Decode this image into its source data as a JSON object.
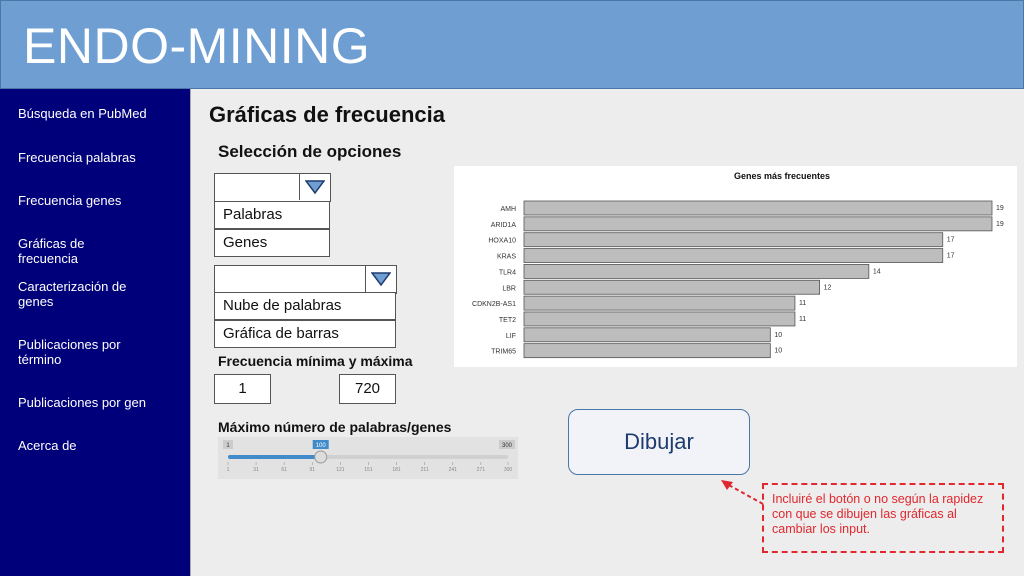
{
  "app": {
    "title": "ENDO-MINING"
  },
  "sidebar": {
    "items": [
      {
        "label": "Búsqueda en PubMed"
      },
      {
        "label": "Frecuencia palabras"
      },
      {
        "label": "Frecuencia genes"
      },
      {
        "label": "Gráficas de frecuencia"
      },
      {
        "label": "Caracterización de genes"
      },
      {
        "label": "Publicaciones por término"
      },
      {
        "label": "Publicaciones por gen"
      },
      {
        "label": "Acerca de"
      }
    ]
  },
  "main": {
    "title": "Gráficas de frecuencia",
    "section_title": "Selección de opciones",
    "dropdown1": {
      "selected": "",
      "options": [
        "Palabras",
        "Genes"
      ]
    },
    "dropdown2": {
      "selected": "",
      "options": [
        "Nube de palabras",
        "Gráfica de barras"
      ]
    },
    "freq_label": "Frecuencia mínima y máxima",
    "freq_min": "1",
    "freq_max": "720",
    "max_words_label": "Máximo número de palabras/genes",
    "slider": {
      "min": "1",
      "max": "300",
      "value": "100",
      "value_num": 100,
      "min_num": 1,
      "max_num": 300,
      "ticks": [
        "1",
        "31",
        "61",
        "91",
        "121",
        "151",
        "181",
        "211",
        "241",
        "271",
        "300"
      ]
    },
    "draw_button": "Dibujar",
    "note": "Incluiré el botón o no según la rapidez con que se dibujen las gráficas al cambiar los input."
  },
  "chart_data": {
    "type": "bar",
    "orientation": "horizontal",
    "title": "Genes más frecuentes",
    "categories": [
      "AMH",
      "ARID1A",
      "HOXA10",
      "KRAS",
      "TLR4",
      "LBR",
      "CDKN2B-AS1",
      "TET2",
      "LIF",
      "TRIM65"
    ],
    "values": [
      19,
      19,
      17,
      17,
      14,
      12,
      11,
      11,
      10,
      10
    ],
    "xlim": [
      0,
      19
    ],
    "bar_color": "#bdbdbd"
  }
}
